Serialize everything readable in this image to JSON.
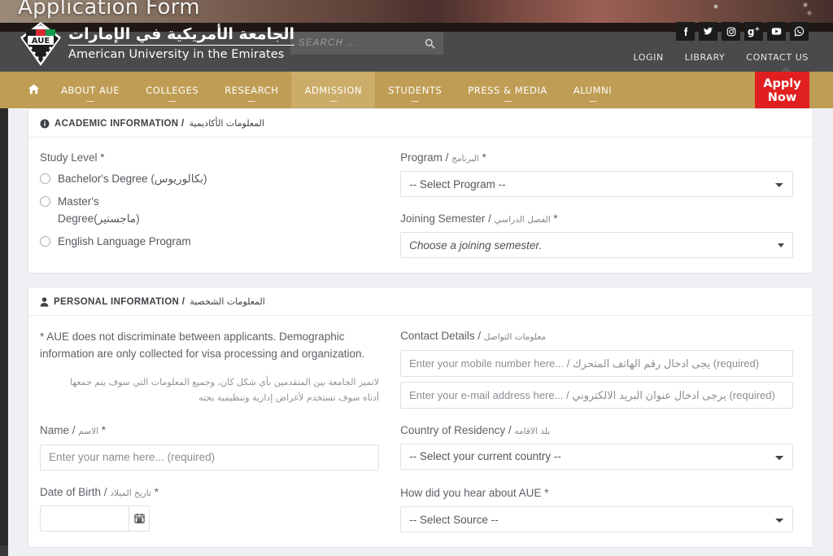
{
  "banner": {
    "title": "Application Form"
  },
  "header": {
    "logo": {
      "mark": "AUE",
      "arabic": "الجامعة الأمريكية في الإمارات",
      "english": "American University in the Emirates"
    },
    "search": {
      "placeholder": "SEARCH ...",
      "icon": "search-icon"
    },
    "socials": [
      {
        "name": "facebook-icon",
        "label": "f"
      },
      {
        "name": "twitter-icon",
        "label": "t"
      },
      {
        "name": "instagram-icon",
        "label": "ig"
      },
      {
        "name": "google-plus-icon",
        "label": "g+"
      },
      {
        "name": "youtube-icon",
        "label": "yt"
      },
      {
        "name": "whatsapp-icon",
        "label": "wa"
      }
    ],
    "utility_links": [
      {
        "label": "LOGIN"
      },
      {
        "label": "LIBRARY"
      },
      {
        "label": "CONTACT US"
      }
    ]
  },
  "nav": {
    "home_icon": "home-icon",
    "items": [
      {
        "label": "ABOUT AUE",
        "active": false
      },
      {
        "label": "COLLEGES",
        "active": false
      },
      {
        "label": "RESEARCH",
        "active": false
      },
      {
        "label": "ADMISSION",
        "active": true
      },
      {
        "label": "STUDENTS",
        "active": false
      },
      {
        "label": "PRESS & MEDIA",
        "active": false
      },
      {
        "label": "ALUMNI",
        "active": false
      }
    ],
    "apply_button": {
      "line1": "Apply",
      "line2": "Now",
      "color": "#e02020"
    }
  },
  "academic": {
    "icon": "info-circle-icon",
    "title_en": "ACADEMIC INFORMATION /",
    "title_ar": "المعلومات الأكاديمية",
    "study_level": {
      "label": "Study Level *",
      "options": [
        "Bachelor's Degree (بكالوريوس)",
        "Master's Degree(ماجستير)",
        "English Language Program"
      ]
    },
    "program": {
      "label_en": "Program /",
      "label_ar": "البرنامج",
      "required": "*",
      "value": "-- Select Program --"
    },
    "joining_semester": {
      "label_en": "Joining Semester /",
      "label_ar": "الفصل الدراسي",
      "required": "*",
      "value": "Choose a joining semester."
    }
  },
  "personal": {
    "icon": "user-icon",
    "title_en": "PERSONAL INFORMATION /",
    "title_ar": "المعلومات الشخصية",
    "notice_en": "* AUE does not discriminate between applicants. Demographic information are only collected for visa processing and organization.",
    "notice_ar": "لاتميز الجامعة بين المتقدمين بأي شكل كان، وجميع المعلومات التي سوف يتم جمعها أدناه سوف تستخدم لأغراض إدارية وتنظيمية بحته",
    "name": {
      "label_en": "Name /",
      "label_ar": "الاسم",
      "required": "*",
      "placeholder": "Enter your name here... (required)",
      "value": ""
    },
    "date_of_birth": {
      "label_en": "Date of Birth /",
      "label_ar": "تاريخ الميلاد",
      "required": "*",
      "value": "",
      "icon": "calendar-icon"
    },
    "contact_details": {
      "label_en": "Contact Details /",
      "label_ar": "معلومات التواصل",
      "mobile_placeholder": "Enter your mobile number here... / يجى ادخال رقم الهاتف المتحرك (required)",
      "mobile_value": "",
      "email_placeholder": "Enter your e-mail address here... / يرجى ادخال عنوان البريد الالكتروني (required)",
      "email_value": ""
    },
    "country_of_residency": {
      "label_en": "Country of Residency /",
      "label_ar": "بلد الاقامه",
      "value": "-- Select your current country --"
    },
    "hear_about": {
      "label": "How did you hear about AUE *",
      "value": "-- Select Source --"
    }
  }
}
